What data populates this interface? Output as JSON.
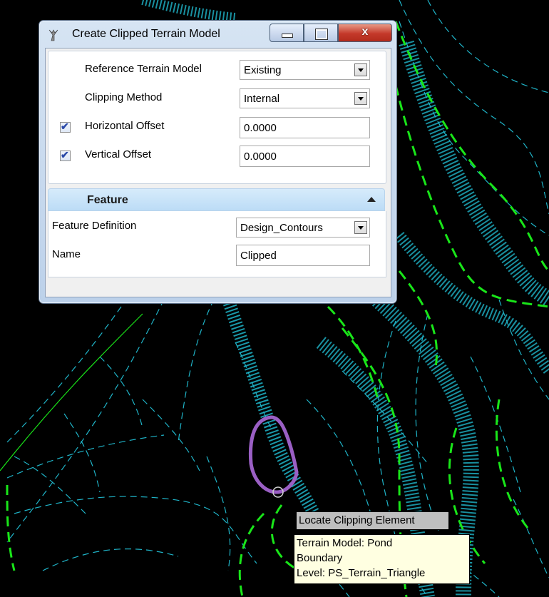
{
  "dialog": {
    "title": "Create Clipped Terrain Model",
    "window_buttons": {
      "minimize": "minimize",
      "maximize": "maximize",
      "close": "x"
    },
    "fields": {
      "reference_terrain_model": {
        "label": "Reference Terrain Model",
        "value": "Existing"
      },
      "clipping_method": {
        "label": "Clipping Method",
        "value": "Internal"
      },
      "horizontal_offset": {
        "label": "Horizontal Offset",
        "value": "0.0000",
        "checked": true
      },
      "vertical_offset": {
        "label": "Vertical Offset",
        "value": "0.0000",
        "checked": true
      }
    },
    "feature_section": {
      "title": "Feature",
      "collapse_icon": "chevron-up-icon",
      "feature_definition": {
        "label": "Feature Definition",
        "value": "Design_Contours"
      },
      "name": {
        "label": "Name",
        "value": "Clipped"
      }
    }
  },
  "cursor_prompt": "Locate Clipping Element",
  "element_info": {
    "line1": "Terrain Model: Pond",
    "line2": "Boundary",
    "line3": "Level: PS_Terrain_Triangle"
  },
  "colors": {
    "background": "#000000",
    "contour_green": "#19e619",
    "triangle_cyan": "#1fb4c8",
    "selection_purple": "#9a5fc4"
  }
}
